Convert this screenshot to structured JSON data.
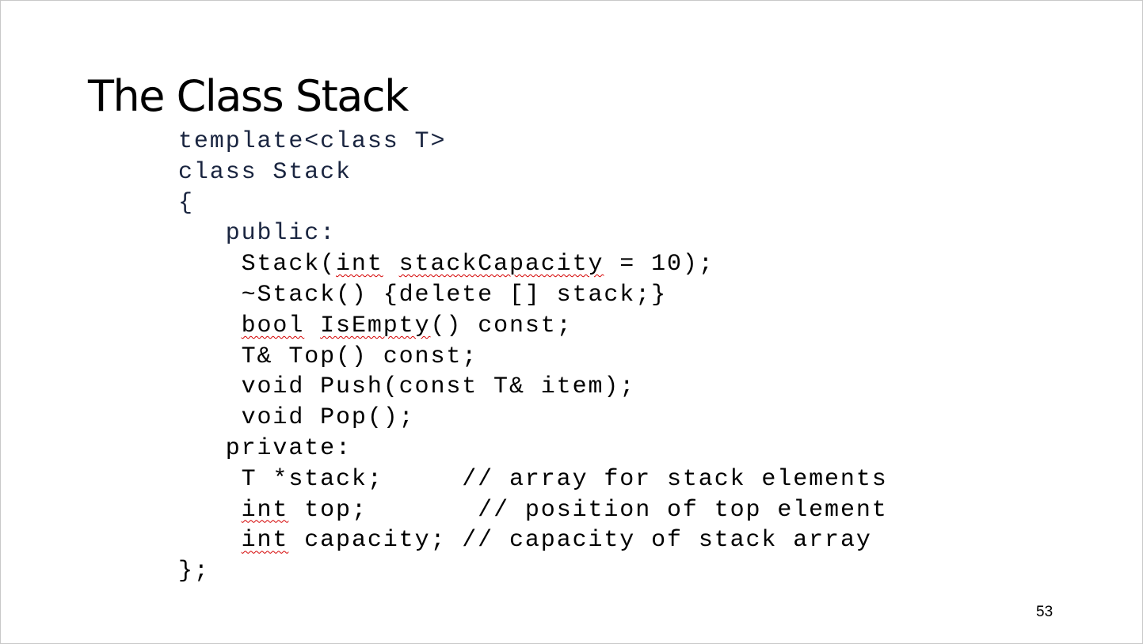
{
  "slide": {
    "title": "The Class Stack",
    "page_number": "53",
    "code": {
      "l1": "template<class T>",
      "l2": "class Stack",
      "l3": "{",
      "l4": "   public:",
      "l5a": "    Stack(",
      "l5b": "int",
      "l5c": " ",
      "l5d": "stackCapacity",
      "l5e": " = 10);",
      "l6": "    ~Stack() {delete [] stack;}",
      "l7a": "    ",
      "l7b": "bool",
      "l7c": " ",
      "l7d": "IsEmpty",
      "l7e": "() const;",
      "l8": "    T& Top() const;",
      "l9": "    void Push(const T& item);",
      "l10": "    void Pop();",
      "l11": "   private:",
      "l12": "    T *stack;     // array for stack elements",
      "l13a": "    ",
      "l13b": "int",
      "l13c": " top;       // position of top element",
      "l14a": "    ",
      "l14b": "int",
      "l14c": " capacity; // capacity of stack array",
      "l15": "};"
    }
  }
}
